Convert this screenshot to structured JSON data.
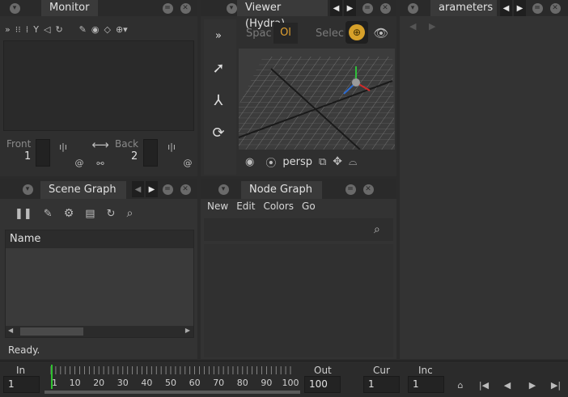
{
  "monitor": {
    "tab_label": "Monitor",
    "toolbar_icons": [
      "collapse-icon",
      "pin-icon",
      "swap-icon",
      "filter-icon",
      "rewind-icon",
      "refresh-icon",
      "pixel-probe-icon",
      "color-wheel-icon",
      "compare-icon",
      "dropdown-icon"
    ],
    "front_label": "Front",
    "front_value": "1",
    "back_label": "Back",
    "back_value": "2"
  },
  "viewer": {
    "tab_label": "Viewer (Hydra)",
    "spaces_label": "Spac",
    "object_value": "Ol",
    "select_label": "Selec",
    "camera_label": "persp"
  },
  "parameters": {
    "tab_label": "arameters"
  },
  "scene_graph": {
    "tab_label": "Scene Graph",
    "column_header": "Name",
    "status": "Ready."
  },
  "node_graph": {
    "tab_label": "Node Graph",
    "menu": [
      "New",
      "Edit",
      "Colors",
      "Go"
    ]
  },
  "timeline": {
    "in_label": "In",
    "in_value": "1",
    "out_label": "Out",
    "out_value": "100",
    "cur_label": "Cur",
    "cur_value": "1",
    "inc_label": "Inc",
    "inc_value": "1",
    "ticks": [
      "1",
      "10",
      "20",
      "30",
      "40",
      "50",
      "60",
      "70",
      "80",
      "90",
      "100"
    ],
    "current_frame_color": "#2fc22f"
  },
  "colors": {
    "accent_orange": "#e0a030",
    "panel": "#333333",
    "background": "#2b2b2b"
  }
}
